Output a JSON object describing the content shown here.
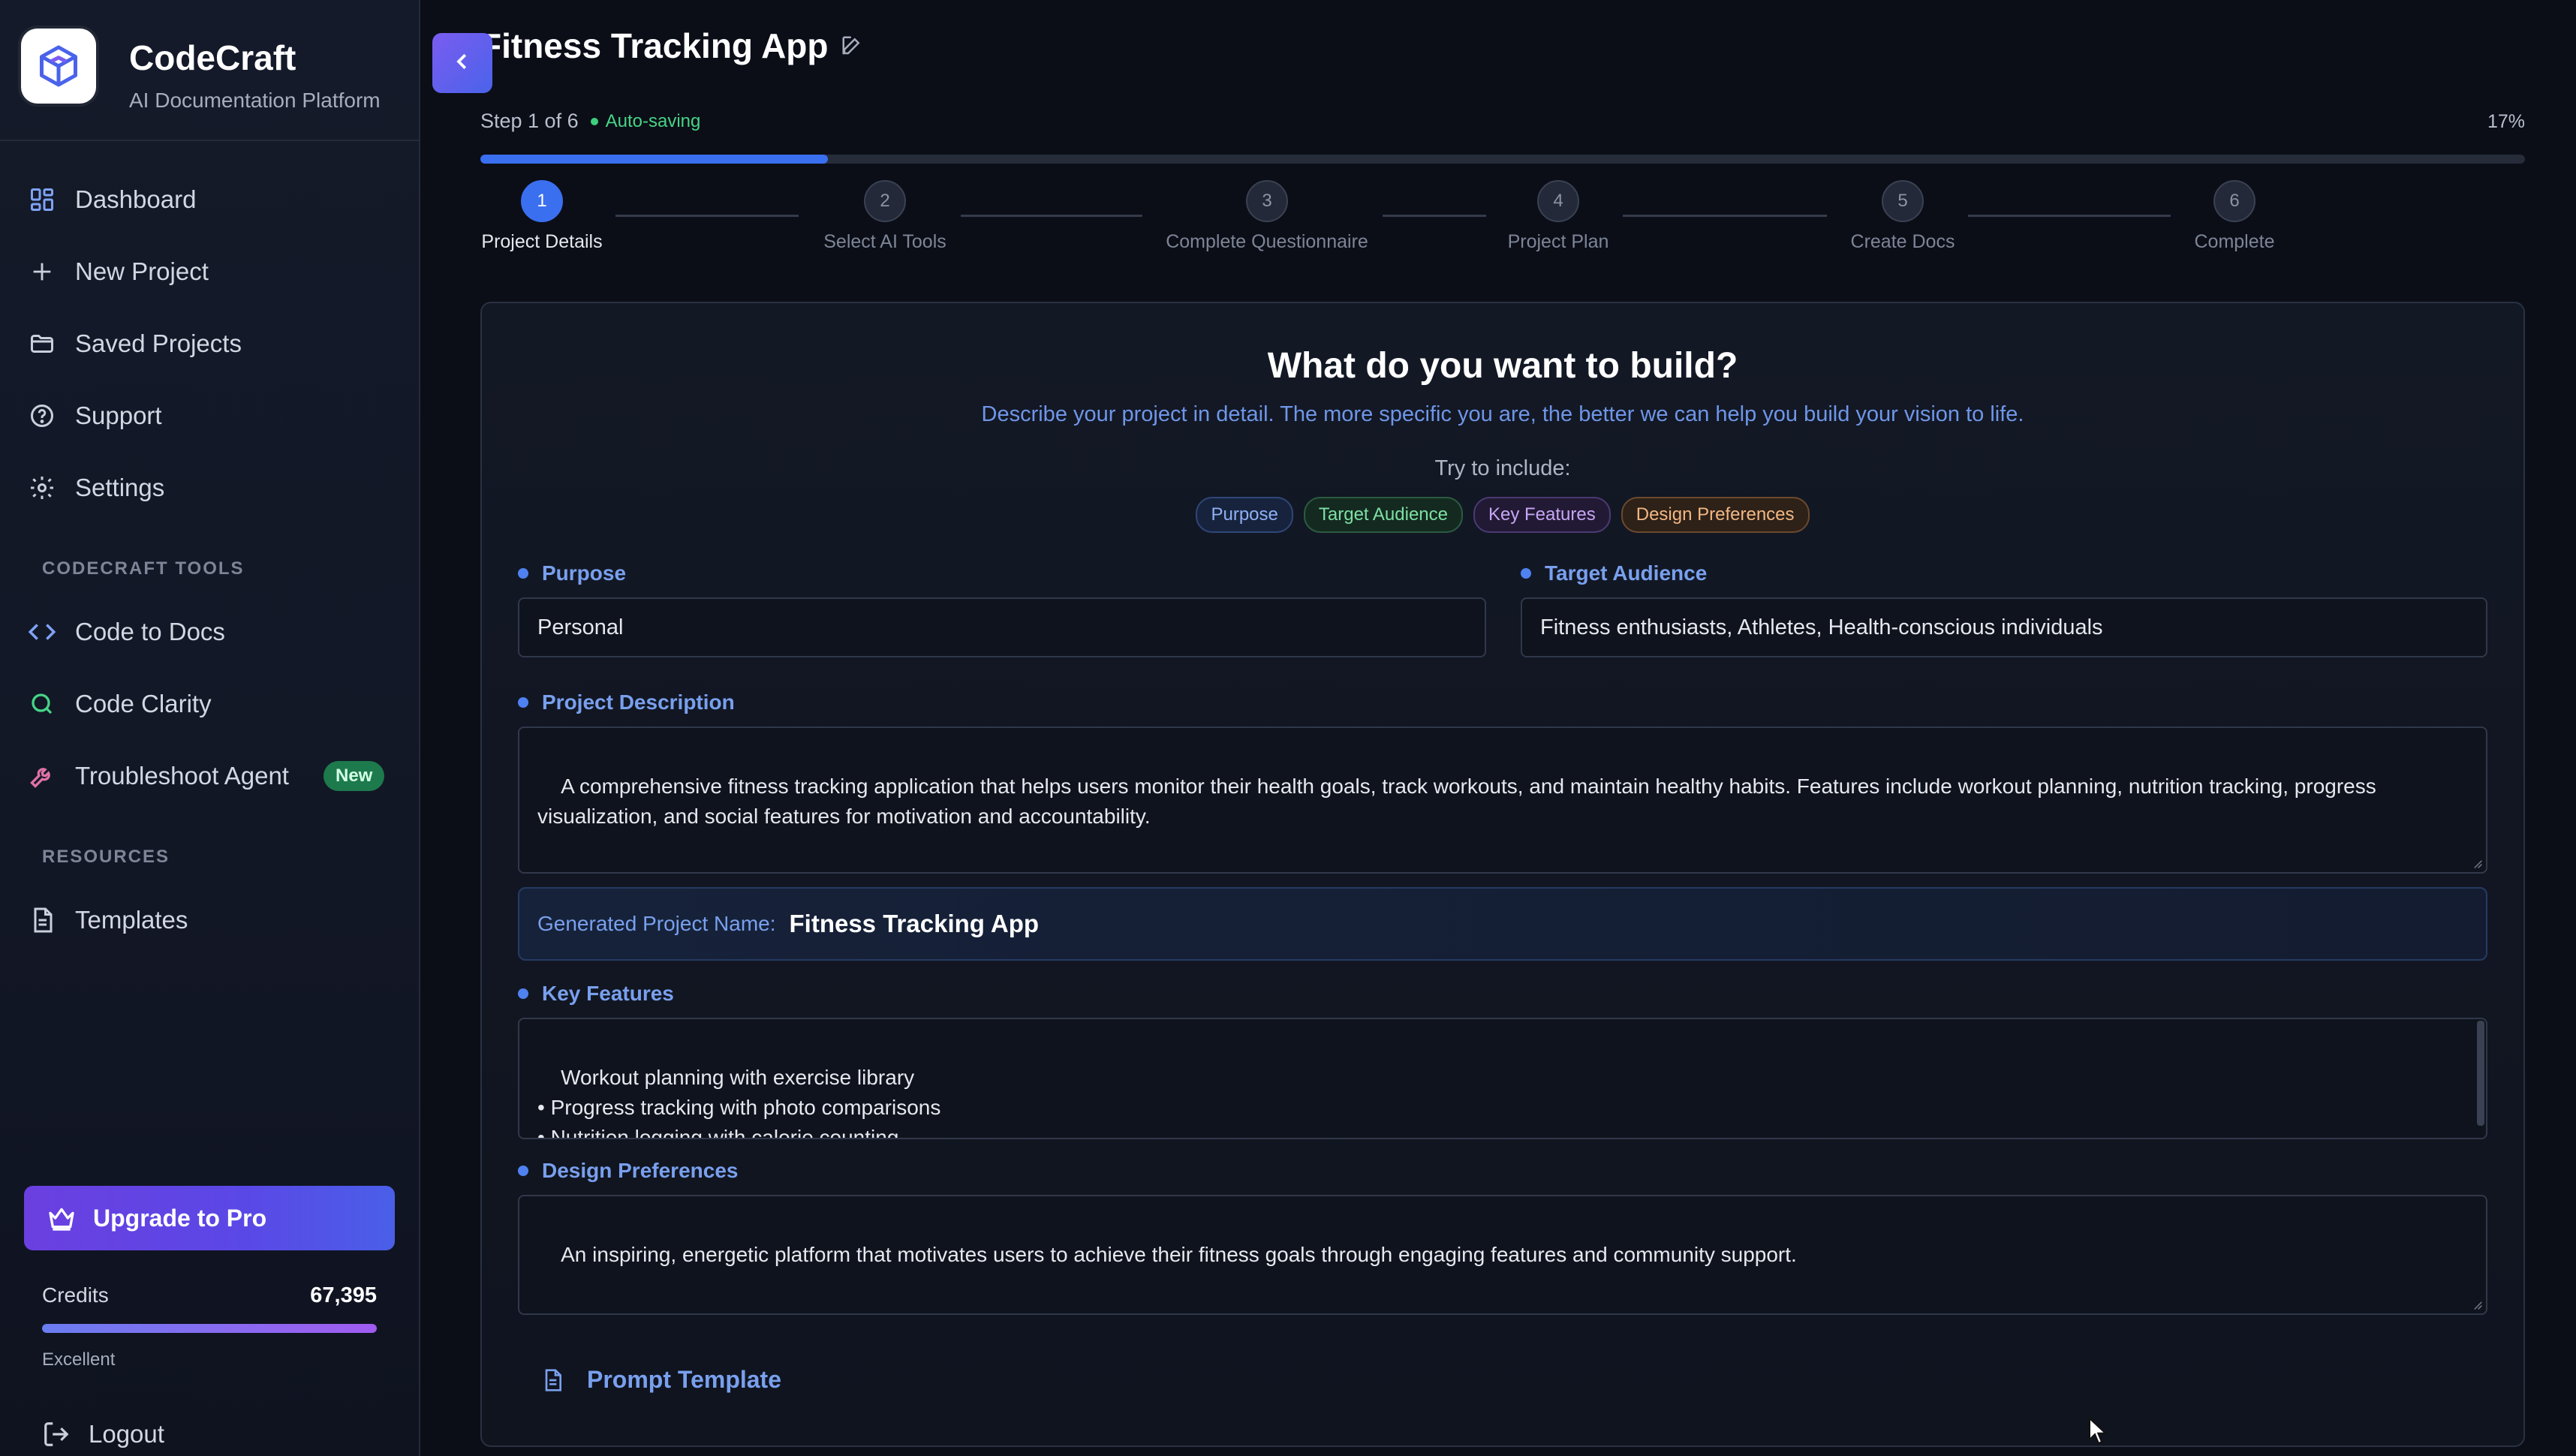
{
  "brand": {
    "title": "CodeCraft",
    "subtitle": "AI Documentation Platform"
  },
  "nav": {
    "items": [
      {
        "label": "Dashboard",
        "icon": "dashboard-icon"
      },
      {
        "label": "New Project",
        "icon": "plus-icon"
      },
      {
        "label": "Saved Projects",
        "icon": "folder-icon"
      },
      {
        "label": "Support",
        "icon": "help-circle-icon"
      },
      {
        "label": "Settings",
        "icon": "gear-icon"
      }
    ],
    "tools_heading": "CODECRAFT TOOLS",
    "tools": [
      {
        "label": "Code to Docs",
        "icon": "code-icon"
      },
      {
        "label": "Code Clarity",
        "icon": "search-icon"
      },
      {
        "label": "Troubleshoot Agent",
        "icon": "wrench-icon",
        "badge": "New"
      }
    ],
    "resources_heading": "RESOURCES",
    "resources": [
      {
        "label": "Templates",
        "icon": "document-icon"
      }
    ]
  },
  "upgrade": {
    "label": "Upgrade to Pro",
    "icon": "crown-icon"
  },
  "credits": {
    "label": "Credits",
    "value": "67,395",
    "status": "Excellent",
    "level": 1.0
  },
  "logout": {
    "label": "Logout",
    "icon": "logout-icon"
  },
  "header": {
    "title": "Fitness Tracking App",
    "step_text": "Step 1 of 6",
    "saving_text": "Auto-saving",
    "percent": "17%",
    "progress": 0.17
  },
  "steps": [
    {
      "num": "1",
      "label": "Project Details",
      "active": true
    },
    {
      "num": "2",
      "label": "Select AI Tools",
      "active": false
    },
    {
      "num": "3",
      "label": "Complete Questionnaire",
      "active": false
    },
    {
      "num": "4",
      "label": "Project Plan",
      "active": false
    },
    {
      "num": "5",
      "label": "Create Docs",
      "active": false
    },
    {
      "num": "6",
      "label": "Complete",
      "active": false
    }
  ],
  "form": {
    "title": "What do you want to build?",
    "subtitle": "Describe your project in detail. The more specific you are, the better we can help you build your vision to life.",
    "try_text": "Try to include:",
    "chips": [
      "Purpose",
      "Target Audience",
      "Key Features",
      "Design Preferences"
    ],
    "purpose_label": "Purpose",
    "purpose_value": "Personal",
    "audience_label": "Target Audience",
    "audience_value": "Fitness enthusiasts, Athletes, Health-conscious individuals",
    "description_label": "Project Description",
    "description_value": "A comprehensive fitness tracking application that helps users monitor their health goals, track workouts, and maintain healthy habits. Features include workout planning, nutrition tracking, progress visualization, and social features for motivation and accountability.",
    "generated_label": "Generated Project Name:",
    "generated_value": "Fitness Tracking App",
    "features_label": "Key Features",
    "features_value": "Workout planning with exercise library\n• Progress tracking with photo comparisons\n• Nutrition logging with calorie counting\n• Heart rate and activity monitoring",
    "design_label": "Design Preferences",
    "design_value": "An inspiring, energetic platform that motivates users to achieve their fitness goals through engaging features and community support.",
    "prompt_template_label": "Prompt Template"
  },
  "colors": {
    "accent": "#3a6ff0",
    "success": "#3ecf7d",
    "brand_gradient": "#6b3fe0"
  }
}
